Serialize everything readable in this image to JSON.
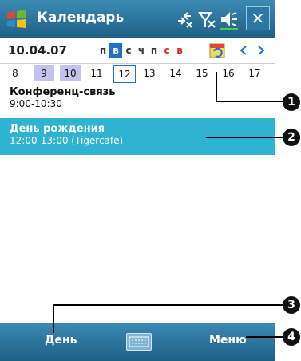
{
  "titlebar": {
    "title": "Календарь",
    "close_label": "✕"
  },
  "datebar": {
    "date": "10.04.07",
    "weekdays": [
      {
        "label": "п",
        "selected": false,
        "weekend": false
      },
      {
        "label": "в",
        "selected": true,
        "weekend": false
      },
      {
        "label": "с",
        "selected": false,
        "weekend": false
      },
      {
        "label": "ч",
        "selected": false,
        "weekend": false
      },
      {
        "label": "п",
        "selected": false,
        "weekend": false
      },
      {
        "label": "с",
        "selected": false,
        "weekend": true
      },
      {
        "label": "в",
        "selected": false,
        "weekend": true
      }
    ]
  },
  "daystrip": {
    "days": [
      "8",
      "9",
      "10",
      "11",
      "12",
      "13",
      "14",
      "15",
      "16",
      "17"
    ]
  },
  "events": [
    {
      "title": "Конференц-связь",
      "time": "9:00-10:30"
    },
    {
      "title": "День рождения",
      "time": "12:00-13:00 (Tigercafe)"
    }
  ],
  "menubar": {
    "left": "День",
    "right": "Меню"
  },
  "markers": [
    "1",
    "2",
    "3",
    "4"
  ],
  "colors": {
    "titlebar": "#2c77a3",
    "selected_event": "#2fb3d1",
    "selected_weekday": "#1e73c8",
    "weekend": "#d22222",
    "highlight_days": "#c6c2f0"
  }
}
